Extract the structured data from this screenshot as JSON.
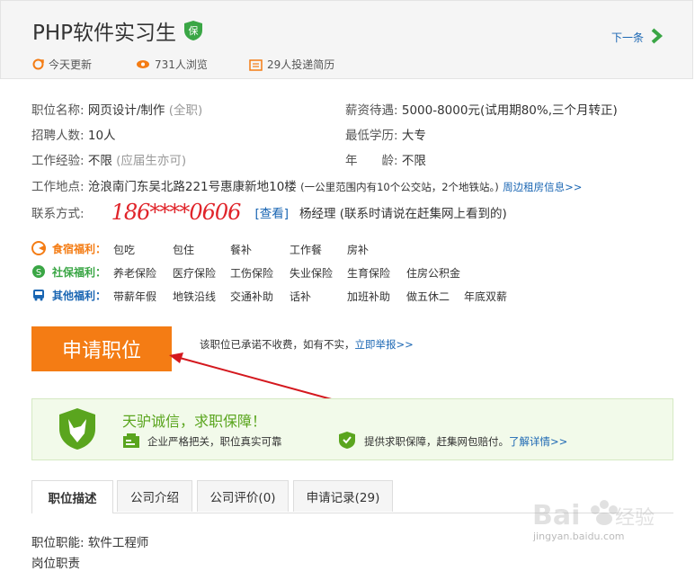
{
  "header": {
    "title": "PHP软件实习生",
    "next_label": "下一条",
    "updated": "今天更新",
    "views": "731人浏览",
    "applicants": "29人投递简历"
  },
  "details": {
    "position_label": "职位名称:",
    "position_value": "网页设计/制作",
    "position_type": "(全职)",
    "salary_label": "薪资待遇:",
    "salary_value": "5000-8000元(试用期80%,三个月转正)",
    "headcount_label": "招聘人数:",
    "headcount_value": "10人",
    "education_label": "最低学历:",
    "education_value": "大专",
    "experience_label": "工作经验:",
    "experience_value": "不限",
    "experience_note": "(应届生亦可)",
    "age_label": "年　　龄:",
    "age_value": "不限",
    "location_label": "工作地点:",
    "location_value": "沧浪南门东吴北路221号惠康新地10楼",
    "location_note": "(一公里范围内有10个公交站，2个地铁站。)",
    "location_link": "周边租房信息>>",
    "contact_label": "联系方式:",
    "phone": "186****0606",
    "view_link": "[查看]",
    "contact_person": "杨经理 (联系时请说在赶集网上看到的)"
  },
  "welfare": {
    "food_label": "食宿福利：",
    "food_items": [
      "包吃",
      "包住",
      "餐补",
      "工作餐",
      "房补"
    ],
    "social_label": "社保福利：",
    "social_items": [
      "养老保险",
      "医疗保险",
      "工伤保险",
      "失业保险",
      "生育保险",
      "住房公积金"
    ],
    "other_label": "其他福利：",
    "other_items": [
      "带薪年假",
      "地铁沿线",
      "交通补助",
      "话补",
      "加班补助",
      "做五休二",
      "年底双薪"
    ]
  },
  "apply": {
    "button_label": "申请职位",
    "notice": "该职位已承诺不收费，如有不实，",
    "report_link": "立即举报>>"
  },
  "guarantee": {
    "title": "天驴诚信，求职保障！",
    "item1": "企业严格把关，职位真实可靠",
    "item2": "提供求职保障，赶集网包赔付。",
    "item2_link": "了解详情>>"
  },
  "tabs": [
    "职位描述",
    "公司介绍",
    "公司评价(0)",
    "申请记录(29)"
  ],
  "description": {
    "function_label": "职位职能:",
    "function_value": "软件工程师",
    "duty_label": "岗位职责"
  },
  "watermark": {
    "text": "jingyan.baidu.com"
  },
  "colors": {
    "accent_orange": "#f47c14",
    "link_blue": "#1a66b3",
    "phone_red": "#e0242a",
    "green": "#5aa51e"
  }
}
